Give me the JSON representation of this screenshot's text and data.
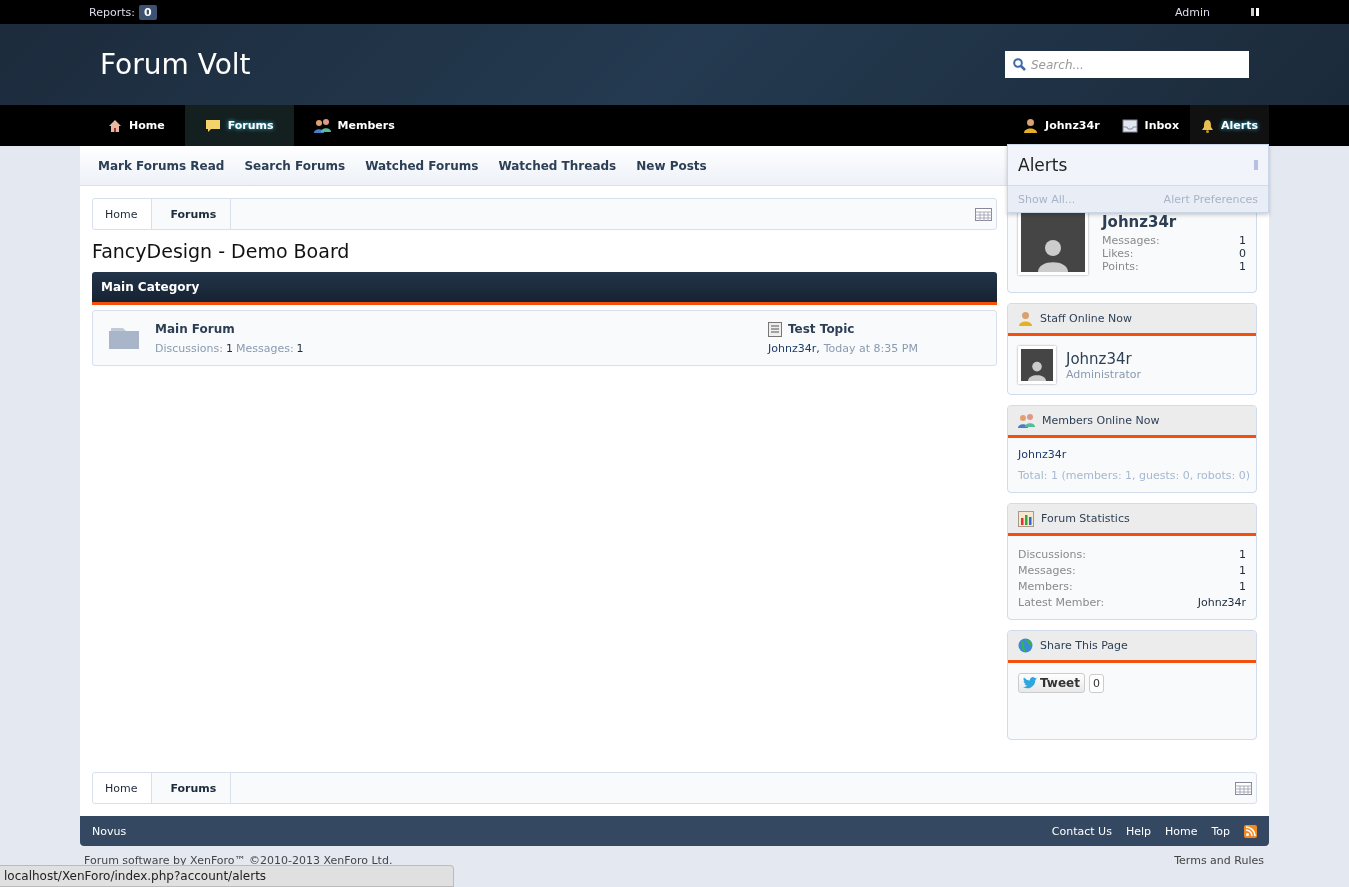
{
  "top_bar": {
    "reports_label": "Reports:",
    "reports_count": "0",
    "user": "Admin"
  },
  "header": {
    "logo": "Forum Volt",
    "search": {
      "placeholder": "Search..."
    }
  },
  "nav": {
    "left": [
      {
        "label": "Home",
        "selected": false
      },
      {
        "label": "Forums",
        "selected": true
      },
      {
        "label": "Members",
        "selected": false
      }
    ],
    "right": [
      {
        "label": "Johnz34r",
        "selected": false
      },
      {
        "label": "Inbox",
        "selected": false
      },
      {
        "label": "Alerts",
        "selected": true
      }
    ]
  },
  "sub_nav": [
    "Mark Forums Read",
    "Search Forums",
    "Watched Forums",
    "Watched Threads",
    "New Posts"
  ],
  "breadcrumb": [
    {
      "label": "Home",
      "current": false
    },
    {
      "label": "Forums",
      "current": true
    }
  ],
  "board_title": "FancyDesign - Demo Board",
  "category": {
    "title": "Main Category",
    "forums": [
      {
        "name": "Main Forum",
        "discussions_label": "Discussions:",
        "discussions": "1",
        "messages_label": "Messages:",
        "messages": "1",
        "last_thread": "Test Topic",
        "last_user": "Johnz34r",
        "separator": ",",
        "last_time": "Today at 8:35 PM"
      }
    ]
  },
  "alerts_popup": {
    "title": "Alerts",
    "show_all": "Show All...",
    "preferences": "Alert Preferences"
  },
  "visitor_panel": {
    "name": "Johnz34r",
    "stats": [
      {
        "label": "Messages:",
        "value": "1"
      },
      {
        "label": "Likes:",
        "value": "0"
      },
      {
        "label": "Points:",
        "value": "1"
      }
    ]
  },
  "sidebar": [
    {
      "kind": "staff",
      "title": "Staff Online Now",
      "name": "Johnz34r",
      "role": "Administrator"
    },
    {
      "kind": "members",
      "title": "Members Online Now",
      "name": "Johnz34r",
      "total": "Total: 1 (members: 1, guests: 0, robots: 0)"
    },
    {
      "kind": "stats",
      "title": "Forum Statistics",
      "stats": [
        {
          "label": "Discussions:",
          "value": "1"
        },
        {
          "label": "Messages:",
          "value": "1"
        },
        {
          "label": "Members:",
          "value": "1"
        },
        {
          "label": "Latest Member:",
          "value": "Johnz34r"
        }
      ]
    },
    {
      "kind": "share",
      "title": "Share This Page",
      "tweet": "Tweet",
      "tweet_count": "0"
    }
  ],
  "bottom_breadcrumb": [
    {
      "label": "Home",
      "current": false
    },
    {
      "label": "Forums",
      "current": true
    }
  ],
  "footer": {
    "left": "Novus",
    "links": [
      "Contact Us",
      "Help",
      "Home",
      "Top"
    ],
    "copyright": "Forum software by XenForo™ ©2010-2013 XenForo Ltd.",
    "terms": "Terms and Rules"
  },
  "status_bar": "localhost/XenForo/index.php?account/alerts"
}
